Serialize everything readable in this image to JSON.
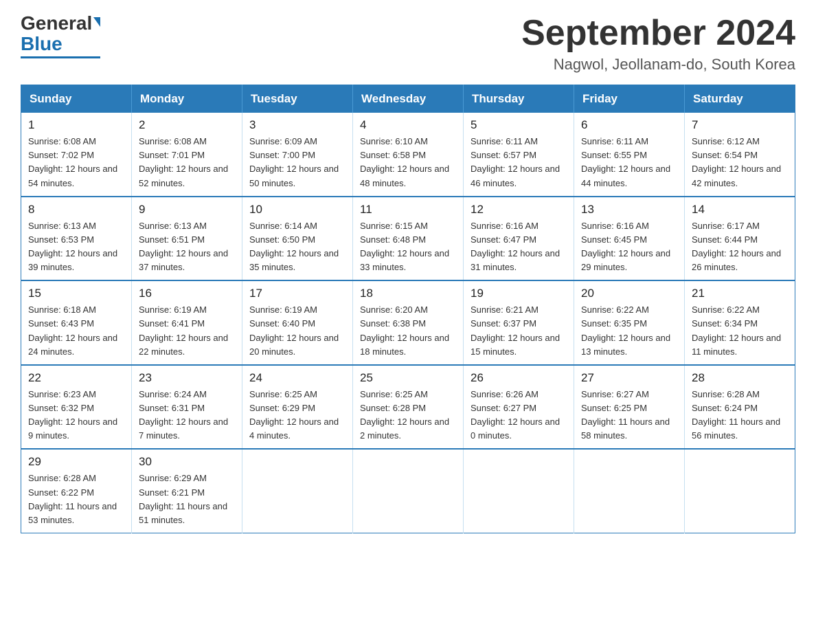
{
  "header": {
    "logo_general": "General",
    "logo_blue": "Blue",
    "month_title": "September 2024",
    "location": "Nagwol, Jeollanam-do, South Korea"
  },
  "weekdays": [
    "Sunday",
    "Monday",
    "Tuesday",
    "Wednesday",
    "Thursday",
    "Friday",
    "Saturday"
  ],
  "weeks": [
    [
      {
        "day": "1",
        "sunrise": "6:08 AM",
        "sunset": "7:02 PM",
        "daylight": "12 hours and 54 minutes."
      },
      {
        "day": "2",
        "sunrise": "6:08 AM",
        "sunset": "7:01 PM",
        "daylight": "12 hours and 52 minutes."
      },
      {
        "day": "3",
        "sunrise": "6:09 AM",
        "sunset": "7:00 PM",
        "daylight": "12 hours and 50 minutes."
      },
      {
        "day": "4",
        "sunrise": "6:10 AM",
        "sunset": "6:58 PM",
        "daylight": "12 hours and 48 minutes."
      },
      {
        "day": "5",
        "sunrise": "6:11 AM",
        "sunset": "6:57 PM",
        "daylight": "12 hours and 46 minutes."
      },
      {
        "day": "6",
        "sunrise": "6:11 AM",
        "sunset": "6:55 PM",
        "daylight": "12 hours and 44 minutes."
      },
      {
        "day": "7",
        "sunrise": "6:12 AM",
        "sunset": "6:54 PM",
        "daylight": "12 hours and 42 minutes."
      }
    ],
    [
      {
        "day": "8",
        "sunrise": "6:13 AM",
        "sunset": "6:53 PM",
        "daylight": "12 hours and 39 minutes."
      },
      {
        "day": "9",
        "sunrise": "6:13 AM",
        "sunset": "6:51 PM",
        "daylight": "12 hours and 37 minutes."
      },
      {
        "day": "10",
        "sunrise": "6:14 AM",
        "sunset": "6:50 PM",
        "daylight": "12 hours and 35 minutes."
      },
      {
        "day": "11",
        "sunrise": "6:15 AM",
        "sunset": "6:48 PM",
        "daylight": "12 hours and 33 minutes."
      },
      {
        "day": "12",
        "sunrise": "6:16 AM",
        "sunset": "6:47 PM",
        "daylight": "12 hours and 31 minutes."
      },
      {
        "day": "13",
        "sunrise": "6:16 AM",
        "sunset": "6:45 PM",
        "daylight": "12 hours and 29 minutes."
      },
      {
        "day": "14",
        "sunrise": "6:17 AM",
        "sunset": "6:44 PM",
        "daylight": "12 hours and 26 minutes."
      }
    ],
    [
      {
        "day": "15",
        "sunrise": "6:18 AM",
        "sunset": "6:43 PM",
        "daylight": "12 hours and 24 minutes."
      },
      {
        "day": "16",
        "sunrise": "6:19 AM",
        "sunset": "6:41 PM",
        "daylight": "12 hours and 22 minutes."
      },
      {
        "day": "17",
        "sunrise": "6:19 AM",
        "sunset": "6:40 PM",
        "daylight": "12 hours and 20 minutes."
      },
      {
        "day": "18",
        "sunrise": "6:20 AM",
        "sunset": "6:38 PM",
        "daylight": "12 hours and 18 minutes."
      },
      {
        "day": "19",
        "sunrise": "6:21 AM",
        "sunset": "6:37 PM",
        "daylight": "12 hours and 15 minutes."
      },
      {
        "day": "20",
        "sunrise": "6:22 AM",
        "sunset": "6:35 PM",
        "daylight": "12 hours and 13 minutes."
      },
      {
        "day": "21",
        "sunrise": "6:22 AM",
        "sunset": "6:34 PM",
        "daylight": "12 hours and 11 minutes."
      }
    ],
    [
      {
        "day": "22",
        "sunrise": "6:23 AM",
        "sunset": "6:32 PM",
        "daylight": "12 hours and 9 minutes."
      },
      {
        "day": "23",
        "sunrise": "6:24 AM",
        "sunset": "6:31 PM",
        "daylight": "12 hours and 7 minutes."
      },
      {
        "day": "24",
        "sunrise": "6:25 AM",
        "sunset": "6:29 PM",
        "daylight": "12 hours and 4 minutes."
      },
      {
        "day": "25",
        "sunrise": "6:25 AM",
        "sunset": "6:28 PM",
        "daylight": "12 hours and 2 minutes."
      },
      {
        "day": "26",
        "sunrise": "6:26 AM",
        "sunset": "6:27 PM",
        "daylight": "12 hours and 0 minutes."
      },
      {
        "day": "27",
        "sunrise": "6:27 AM",
        "sunset": "6:25 PM",
        "daylight": "11 hours and 58 minutes."
      },
      {
        "day": "28",
        "sunrise": "6:28 AM",
        "sunset": "6:24 PM",
        "daylight": "11 hours and 56 minutes."
      }
    ],
    [
      {
        "day": "29",
        "sunrise": "6:28 AM",
        "sunset": "6:22 PM",
        "daylight": "11 hours and 53 minutes."
      },
      {
        "day": "30",
        "sunrise": "6:29 AM",
        "sunset": "6:21 PM",
        "daylight": "11 hours and 51 minutes."
      },
      null,
      null,
      null,
      null,
      null
    ]
  ]
}
